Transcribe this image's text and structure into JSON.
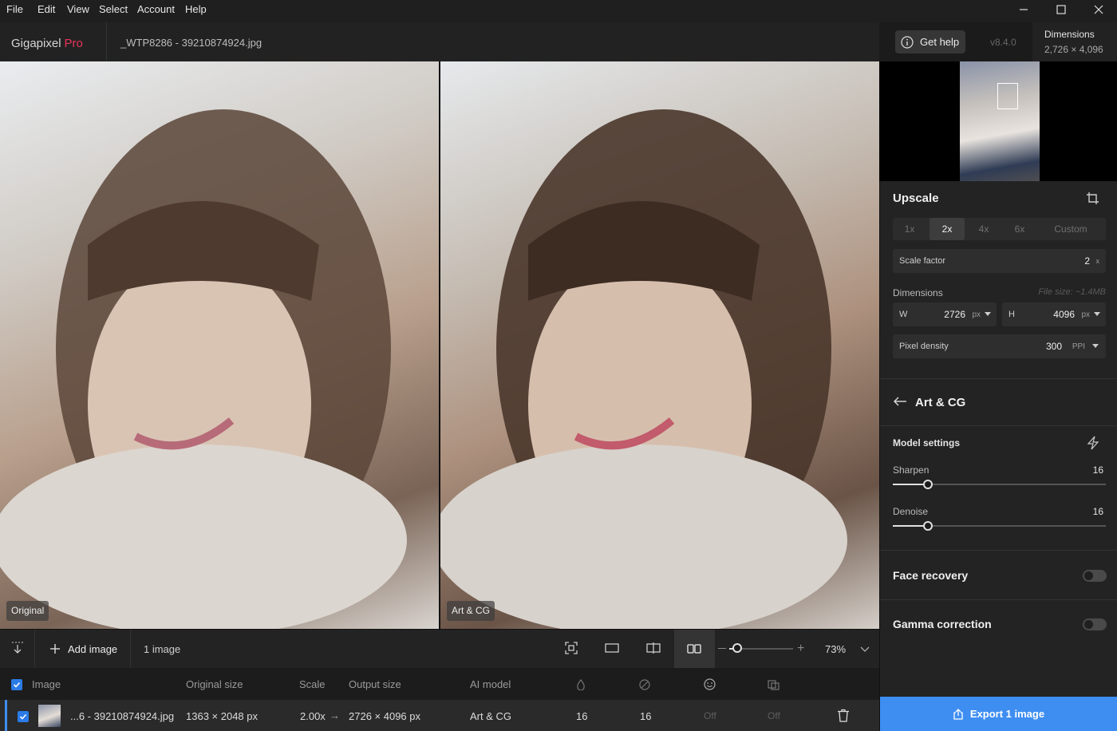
{
  "menu": {
    "file": "File",
    "edit": "Edit",
    "view": "View",
    "select": "Select",
    "account": "Account",
    "help": "Help"
  },
  "app": {
    "name": "Gigapixel",
    "tier": "Pro",
    "filename": "_WTP8286 - 39210874924.jpg",
    "help_label": "Get help",
    "version": "v8.4.0"
  },
  "header_dims": {
    "label": "Dimensions",
    "value": "2,726 × 4,096"
  },
  "viewer": {
    "left_label": "Original",
    "right_label": "Art & CG"
  },
  "toolbar": {
    "add_label": "Add image",
    "count": "1 image",
    "zoom": "73%",
    "zoom_level": 0.3
  },
  "table": {
    "headers": {
      "image": "Image",
      "orig": "Original size",
      "scale": "Scale",
      "output": "Output size",
      "model": "AI model"
    },
    "row": {
      "name": "...6 - 39210874924.jpg",
      "orig": "1363 × 2048 px",
      "scale": "2.00x",
      "output": "2726 × 4096 px",
      "model": "Art & CG",
      "v1": "16",
      "v2": "16",
      "v3": "Off",
      "v4": "Off"
    }
  },
  "upscale": {
    "title": "Upscale",
    "options": [
      "1x",
      "2x",
      "4x",
      "6x",
      "Custom"
    ],
    "selected": "2x",
    "scale_label": "Scale factor",
    "scale_value": "2",
    "scale_unit": "x",
    "dims_label": "Dimensions",
    "file_size": "File size: ~1.4MB",
    "w_label": "W",
    "w_value": "2726",
    "w_unit": "px",
    "h_label": "H",
    "h_value": "4096",
    "h_unit": "px",
    "density_label": "Pixel density",
    "density_value": "300",
    "density_unit": "PPI"
  },
  "model": {
    "name": "Art & CG",
    "settings_label": "Model settings",
    "sharpen_label": "Sharpen",
    "sharpen_value": "16",
    "denoise_label": "Denoise",
    "denoise_value": "16"
  },
  "face_recovery": {
    "label": "Face recovery",
    "enabled": false
  },
  "gamma": {
    "label": "Gamma correction",
    "enabled": false
  },
  "export": {
    "label": "Export 1 image"
  },
  "colors": {
    "accent": "#3e8ef2",
    "brand": "#e8345a"
  }
}
